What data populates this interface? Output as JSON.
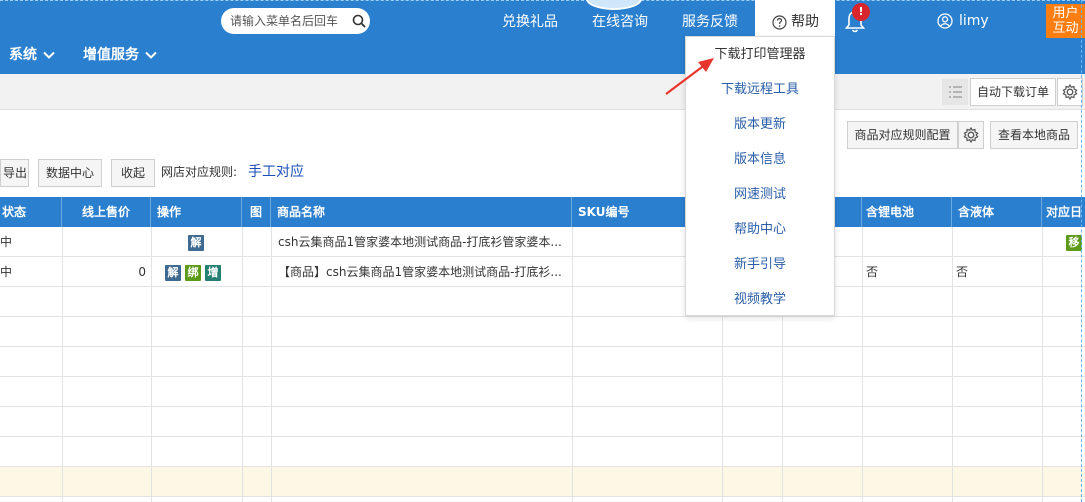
{
  "header": {
    "search_placeholder": "请输入菜单名后回车",
    "links": [
      "兑换礼品",
      "在线咨询",
      "服务反馈"
    ],
    "help_label": "帮助",
    "notification_badge": "!",
    "username": "limy",
    "user_badge_line1": "用户",
    "user_badge_line2": "互动"
  },
  "nav": {
    "items": [
      "系统",
      "增值服务"
    ]
  },
  "toolbar": {
    "auto_download_label": "自动下载订单"
  },
  "actions": {
    "export_label": "导出",
    "data_center_label": "数据中心",
    "collapse_label": "收起",
    "rule_label": "网店对应规则:",
    "rule_value": "手工对应",
    "product_rule_config_label": "商品对应规则配置",
    "view_local_products_label": "查看本地商品"
  },
  "table": {
    "columns": [
      "状态",
      "线上售价",
      "操作",
      "图",
      "商品名称",
      "SKU编号",
      "",
      "",
      "含锂电池",
      "含液体",
      "对应日"
    ],
    "rows": [
      {
        "status": "中",
        "price": "",
        "ops": [
          "解"
        ],
        "name": "csh云集商品1管家婆本地测试商品-打底衫管家婆本...",
        "battery": "",
        "liquid": "",
        "tag_right": "移"
      },
      {
        "status": "中",
        "price": "0",
        "ops": [
          "解",
          "绑",
          "增"
        ],
        "name": "【商品】csh云集商品1管家婆本地测试商品-打底衫...",
        "battery": "否",
        "liquid": "否",
        "tag_right": ""
      }
    ]
  },
  "help_menu": {
    "items": [
      "下载打印管理器",
      "下载远程工具",
      "版本更新",
      "版本信息",
      "网速测试",
      "帮助中心",
      "新手引导",
      "视频教学"
    ]
  },
  "colors": {
    "header_blue": "#2a7fcf",
    "accent_orange": "#ff7e11",
    "badge_red": "#d9262c",
    "link_blue": "#1a4fb8"
  }
}
